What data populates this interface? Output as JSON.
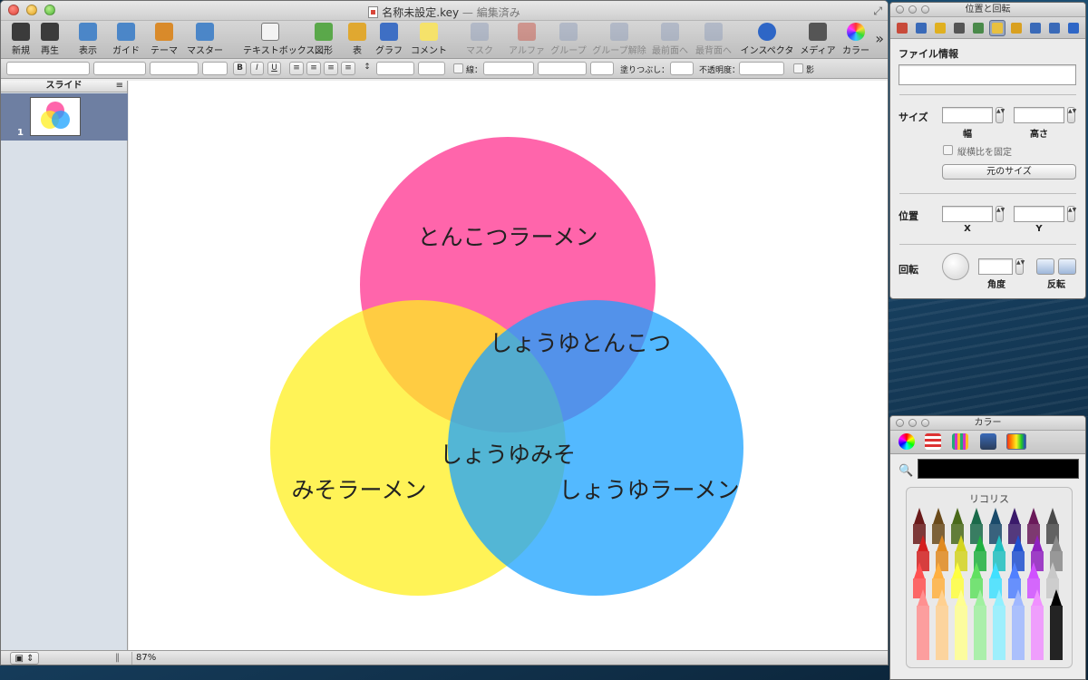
{
  "window": {
    "title": "名称未設定.key",
    "title_suffix": "— 編集済み"
  },
  "toolbar": {
    "items": [
      {
        "label": "新規",
        "icon": "new-icon",
        "color": "#3b3b3b",
        "disabled": false
      },
      {
        "label": "再生",
        "icon": "play-icon",
        "color": "#3b3b3b",
        "disabled": false
      },
      {
        "label": "表示",
        "icon": "view-icon",
        "color": "#4b86c8",
        "disabled": false
      },
      {
        "label": "ガイド",
        "icon": "guide-icon",
        "color": "#4b86c8",
        "disabled": false
      },
      {
        "label": "テーマ",
        "icon": "theme-icon",
        "color": "#d98a2a",
        "disabled": false
      },
      {
        "label": "マスター",
        "icon": "master-icon",
        "color": "#4b86c8",
        "disabled": false
      },
      {
        "label": "テキストボックス",
        "icon": "textbox-icon",
        "color": "#555555",
        "disabled": false
      },
      {
        "label": "図形",
        "icon": "shape-icon",
        "color": "#5aa84a",
        "disabled": false
      },
      {
        "label": "表",
        "icon": "table-icon",
        "color": "#e0a830",
        "disabled": false
      },
      {
        "label": "グラフ",
        "icon": "chart-icon",
        "color": "#3e6fc4",
        "disabled": false
      },
      {
        "label": "コメント",
        "icon": "comment-icon",
        "color": "#f5e26a",
        "disabled": false
      },
      {
        "label": "マスク",
        "icon": "mask-icon",
        "color": "#8a9ab8",
        "disabled": true
      },
      {
        "label": "アルファ",
        "icon": "alpha-icon",
        "color": "#c84a3a",
        "disabled": true
      },
      {
        "label": "グループ",
        "icon": "group-icon",
        "color": "#8a9ab8",
        "disabled": true
      },
      {
        "label": "グループ解除",
        "icon": "ungroup-icon",
        "color": "#8a9ab8",
        "disabled": true
      },
      {
        "label": "最前面へ",
        "icon": "front-icon",
        "color": "#8a9ab8",
        "disabled": true
      },
      {
        "label": "最背面へ",
        "icon": "back-icon",
        "color": "#8a9ab8",
        "disabled": true
      },
      {
        "label": "インスペクタ",
        "icon": "inspector-icon",
        "color": "#2e66c6",
        "disabled": false
      },
      {
        "label": "メディア",
        "icon": "media-icon",
        "color": "#555555",
        "disabled": false
      },
      {
        "label": "カラー",
        "icon": "color-icon",
        "color": "#d94a9a",
        "disabled": false
      }
    ]
  },
  "formatbar": {
    "bold": "B",
    "italic": "I",
    "underline": "U",
    "line_label": "線：",
    "fill_label": "塗りつぶし：",
    "opacity_label": "不透明度：",
    "shadow_label": "影"
  },
  "sidebar": {
    "header": "スライド",
    "slide_number": "1"
  },
  "zoom": "87%",
  "venn": {
    "circles": [
      {
        "label": "とんこつラーメン",
        "color": "#ff3f96"
      },
      {
        "label": "みそラーメン",
        "color": "#ffef1f"
      },
      {
        "label": "しょうゆラーメン",
        "color": "#1aa2ff"
      }
    ],
    "overlaps": [
      {
        "label": "しょうゆとんこつ"
      },
      {
        "label": "しょうゆみそ"
      }
    ]
  },
  "inspector": {
    "title": "位置と回転",
    "file_info": "ファイル情報",
    "size_label": "サイズ",
    "width_label": "幅",
    "height_label": "高さ",
    "lock_ratio": "縦横比を固定",
    "original_size": "元のサイズ",
    "position_label": "位置",
    "x_label": "X",
    "y_label": "Y",
    "rotation_label": "回転",
    "angle_label": "角度",
    "flip_label": "反転"
  },
  "colors_panel": {
    "title": "カラー",
    "crayon_name": "リコリス",
    "crayon_colors": [
      "#6a1a1a",
      "#6a4a1a",
      "#4a6a1a",
      "#1a6a4a",
      "#1a4a6a",
      "#3a1a6a",
      "#6a1a5a",
      "#4a4a4a",
      "#d42020",
      "#e08a20",
      "#d4d420",
      "#20b040",
      "#20c0c0",
      "#2050d0",
      "#9020c0",
      "#8a8a8a",
      "#ff5050",
      "#ffb040",
      "#ffff40",
      "#60e060",
      "#40e0ff",
      "#5080ff",
      "#d050ff",
      "#c8c8c8",
      "#ff9090",
      "#ffd090",
      "#ffff90",
      "#a0f0a0",
      "#90f0ff",
      "#a0b8ff",
      "#f090ff",
      "#000000"
    ]
  }
}
